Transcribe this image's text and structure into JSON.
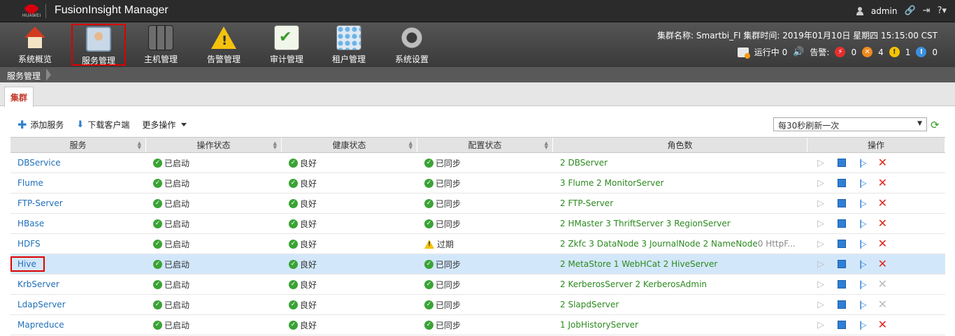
{
  "app": {
    "brand": "HUAWEI",
    "title": "FusionInsight Manager",
    "user": "admin"
  },
  "nav": {
    "items": [
      {
        "label": "系统概览",
        "icon": "home-icon"
      },
      {
        "label": "服务管理",
        "icon": "service-icon"
      },
      {
        "label": "主机管理",
        "icon": "host-icon"
      },
      {
        "label": "告警管理",
        "icon": "alarm-icon"
      },
      {
        "label": "审计管理",
        "icon": "audit-icon"
      },
      {
        "label": "租户管理",
        "icon": "tenant-icon"
      },
      {
        "label": "系统设置",
        "icon": "settings-icon"
      }
    ],
    "active": "服务管理"
  },
  "cluster": {
    "info": "集群名称: Smartbi_FI   集群时间: 2019年01月10日 星期四 15:15:00 CST",
    "running": "运行中 0",
    "alarm_label": "告警:",
    "alarms": {
      "critical": "0",
      "major": "4",
      "minor": "1",
      "warning": "0"
    },
    "colors": {
      "critical": "#e62e2e",
      "major": "#f08a1c",
      "minor": "#f5c400",
      "warning": "#3b8fe0"
    }
  },
  "breadcrumb": {
    "current": "服务管理"
  },
  "tabs": {
    "cluster": "集群"
  },
  "toolbar": {
    "add_service": "添加服务",
    "download_client": "下载客户端",
    "more_actions": "更多操作",
    "refresh_option": "每30秒刷新一次"
  },
  "table": {
    "headers": {
      "service": "服务",
      "op_status": "操作状态",
      "health": "健康状态",
      "config": "配置状态",
      "roles": "角色数",
      "actions": "操作"
    },
    "rows": [
      {
        "service": "DBService",
        "op": "已启动",
        "health": "良好",
        "config": "已同步",
        "config_warn": false,
        "roles": "2 DBServer",
        "roles_extra": "",
        "delete_enabled": true
      },
      {
        "service": "Flume",
        "op": "已启动",
        "health": "良好",
        "config": "已同步",
        "config_warn": false,
        "roles": "3 Flume  2 MonitorServer",
        "roles_extra": "",
        "delete_enabled": true
      },
      {
        "service": "FTP-Server",
        "op": "已启动",
        "health": "良好",
        "config": "已同步",
        "config_warn": false,
        "roles": "2 FTP-Server",
        "roles_extra": "",
        "delete_enabled": true
      },
      {
        "service": "HBase",
        "op": "已启动",
        "health": "良好",
        "config": "已同步",
        "config_warn": false,
        "roles": "2 HMaster  3 ThriftServer  3 RegionServer",
        "roles_extra": "",
        "delete_enabled": true
      },
      {
        "service": "HDFS",
        "op": "已启动",
        "health": "良好",
        "config": "过期",
        "config_warn": true,
        "roles": "2 Zkfc  3 DataNode  3 JournalNode  2 NameNode",
        "roles_extra": "  0 HttpF...",
        "delete_enabled": true
      },
      {
        "service": "Hive",
        "op": "已启动",
        "health": "良好",
        "config": "已同步",
        "config_warn": false,
        "roles": "2 MetaStore  1 WebHCat  2 HiveServer",
        "roles_extra": "",
        "delete_enabled": true,
        "selected": true
      },
      {
        "service": "KrbServer",
        "op": "已启动",
        "health": "良好",
        "config": "已同步",
        "config_warn": false,
        "roles": "2 KerberosServer  2 KerberosAdmin",
        "roles_extra": "",
        "delete_enabled": false
      },
      {
        "service": "LdapServer",
        "op": "已启动",
        "health": "良好",
        "config": "已同步",
        "config_warn": false,
        "roles": "2 SlapdServer",
        "roles_extra": "",
        "delete_enabled": false
      },
      {
        "service": "Mapreduce",
        "op": "已启动",
        "health": "良好",
        "config": "已同步",
        "config_warn": false,
        "roles": "1 JobHistoryServer",
        "roles_extra": "",
        "delete_enabled": true
      }
    ]
  }
}
